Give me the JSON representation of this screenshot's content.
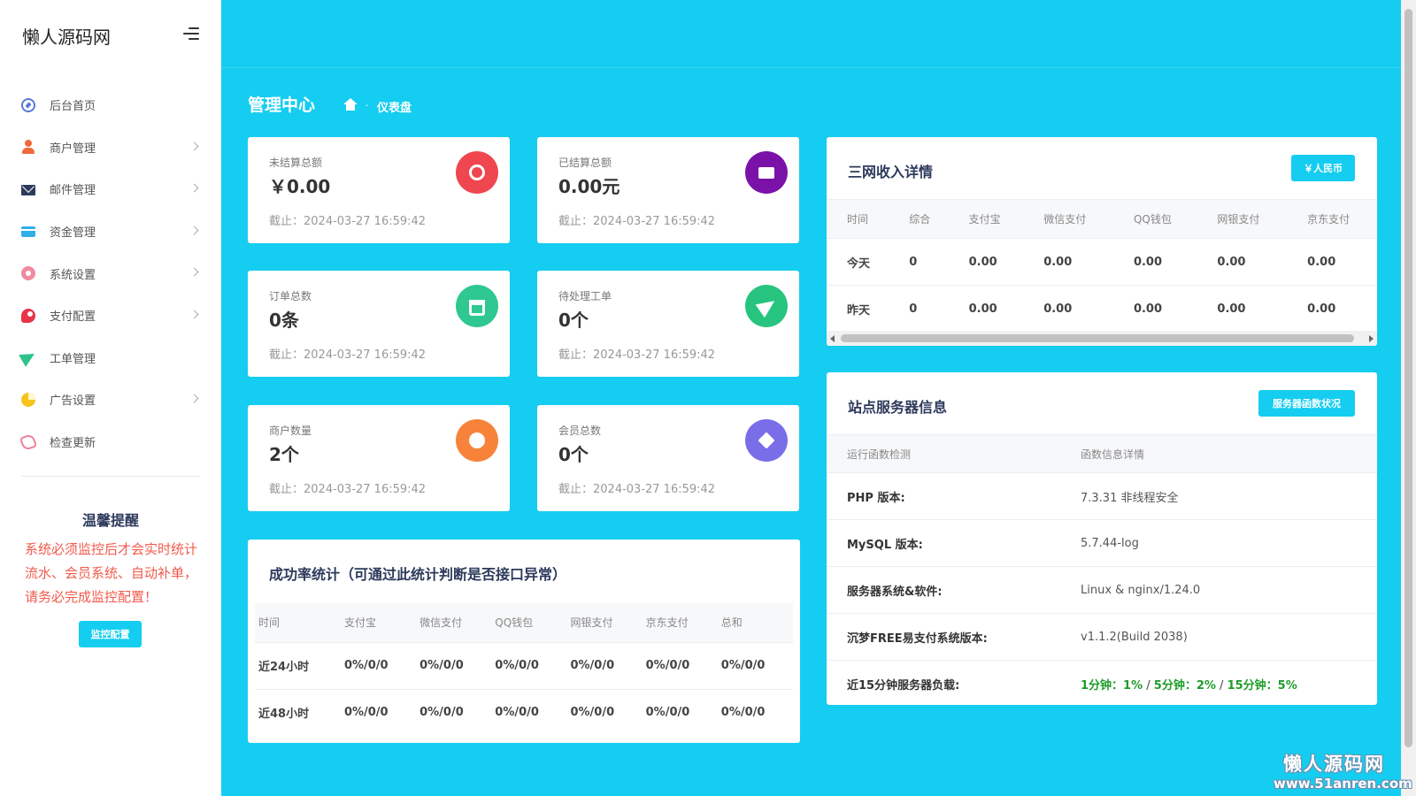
{
  "sidebar": {
    "brand": "懒人源码网",
    "items": [
      {
        "label": "后台首页",
        "icon": "compass-icon",
        "arrow": false
      },
      {
        "label": "商户管理",
        "icon": "user-icon",
        "arrow": true
      },
      {
        "label": "邮件管理",
        "icon": "mail-icon",
        "arrow": true
      },
      {
        "label": "资金管理",
        "icon": "credit-card-icon",
        "arrow": true
      },
      {
        "label": "系统设置",
        "icon": "gear-icon",
        "arrow": true
      },
      {
        "label": "支付配置",
        "icon": "payment-icon",
        "arrow": true
      },
      {
        "label": "工单管理",
        "icon": "paper-plane-icon",
        "arrow": false
      },
      {
        "label": "广告设置",
        "icon": "pie-chart-icon",
        "arrow": true
      },
      {
        "label": "检查更新",
        "icon": "rocket-icon",
        "arrow": false
      }
    ],
    "tip": {
      "title": "温馨提醒",
      "text": "系统必须监控后才会实时统计流水、会员系统、自动补单，请务必完成监控配置！",
      "button": "监控配置"
    }
  },
  "breadcrumb": {
    "title": "管理中心",
    "separator": "-",
    "current": "仪表盘"
  },
  "stats": [
    {
      "label": "未结算总额",
      "value": "￥0.00",
      "time": "截止：2024-03-27 16:59:42",
      "icon": "pie-chart-icon",
      "color": "#f0464f"
    },
    {
      "label": "已结算总额",
      "value": "0.00元",
      "time": "截止：2024-03-27 16:59:42",
      "icon": "wallet-icon",
      "color": "#7a12a8"
    },
    {
      "label": "订单总数",
      "value": "0条",
      "time": "截止：2024-03-27 16:59:42",
      "icon": "cart-icon",
      "color": "#2ec890"
    },
    {
      "label": "待处理工单",
      "value": "0个",
      "time": "截止：2024-03-27 16:59:42",
      "icon": "send-icon",
      "color": "#26c47e"
    },
    {
      "label": "商户数量",
      "value": "2个",
      "time": "截止：2024-03-27 16:59:42",
      "icon": "person-icon",
      "color": "#f7833a"
    },
    {
      "label": "会员总数",
      "value": "0个",
      "time": "截止：2024-03-27 16:59:42",
      "icon": "cube-icon",
      "color": "#7a6de8"
    }
  ],
  "success_rate": {
    "title": "成功率统计（可通过此统计判断是否接口异常）",
    "headers": [
      "时间",
      "支付宝",
      "微信支付",
      "QQ钱包",
      "网银支付",
      "京东支付",
      "总和"
    ],
    "rows": [
      [
        "近24小时",
        "0%/0/0",
        "0%/0/0",
        "0%/0/0",
        "0%/0/0",
        "0%/0/0",
        "0%/0/0"
      ],
      [
        "近48小时",
        "0%/0/0",
        "0%/0/0",
        "0%/0/0",
        "0%/0/0",
        "0%/0/0",
        "0%/0/0"
      ]
    ]
  },
  "income": {
    "title": "三网收入详情",
    "button": "￥人民币",
    "headers": [
      "时间",
      "综合",
      "支付宝",
      "微信支付",
      "QQ钱包",
      "网银支付",
      "京东支付"
    ],
    "rows": [
      [
        "今天",
        "0",
        "0.00",
        "0.00",
        "0.00",
        "0.00",
        "0.00"
      ],
      [
        "昨天",
        "0",
        "0.00",
        "0.00",
        "0.00",
        "0.00",
        "0.00"
      ]
    ]
  },
  "server": {
    "title": "站点服务器信息",
    "button": "服务器函数状况",
    "headers": [
      "运行函数检测",
      "函数信息详情"
    ],
    "rows": [
      [
        "PHP 版本:",
        "7.3.31 非线程安全"
      ],
      [
        "MySQL 版本:",
        "5.7.44-log"
      ],
      [
        "服务器系统&软件:",
        "Linux & nginx/1.24.0"
      ],
      [
        "沉梦FREE易支付系统版本:",
        "v1.1.2(Build 2038)"
      ]
    ],
    "load_label": "近15分钟服务器负载:",
    "load": [
      {
        "text": "1分钟：1%"
      },
      {
        "text": "5分钟：2%"
      },
      {
        "text": "15分钟：5%"
      }
    ],
    "load_separator": " / "
  },
  "watermark": {
    "line1": "懒人源码网",
    "line2": "www.51anren.com"
  },
  "colors": {
    "accent": "#14cdf0",
    "tip_text": "#f25a4c",
    "load_green": "#1e9c2a"
  }
}
